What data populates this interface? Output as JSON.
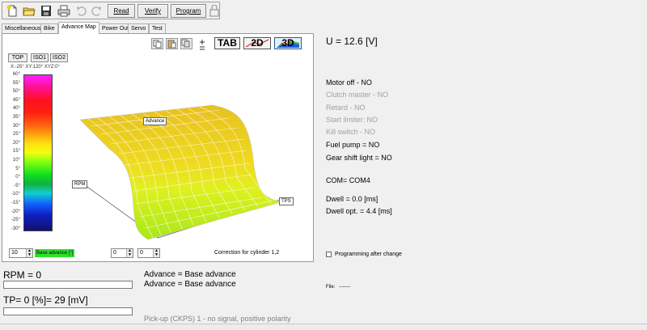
{
  "toolbar": {
    "icons": [
      "new-file-icon",
      "open-folder-icon",
      "save-icon",
      "print-icon",
      "undo-icon",
      "redo-icon",
      "lock-icon"
    ],
    "read_label": "Read",
    "verify_label": "Verify",
    "program_label": "Program"
  },
  "tabs": [
    {
      "label": "Miscellaneous"
    },
    {
      "label": "Bike"
    },
    {
      "label": "Advance Map",
      "active": true
    },
    {
      "label": "Power Out"
    },
    {
      "label": "Servo"
    },
    {
      "label": "Test"
    }
  ],
  "map_panel": {
    "view_buttons": {
      "top": "TOP",
      "iso1": "ISO1",
      "iso2": "ISO2"
    },
    "rotation_text": "X:-25° XY:120° XYZ:0°",
    "mode_buttons": {
      "tab": "TAB",
      "two_d": "2D",
      "three_d": "3D"
    },
    "color_scale": [
      "60°",
      "55°",
      "50°",
      "45°",
      "40°",
      "35°",
      "30°",
      "25°",
      "20°",
      "15°",
      "10°",
      "5°",
      "0°",
      "-5°",
      "-10°",
      "-15°",
      "-20°",
      "-25°",
      "-30°"
    ],
    "axis_labels": {
      "advance": "Advance",
      "rpm": "RPM",
      "tps": "TPS"
    },
    "zoom_value": "10",
    "base_advance_label": "Base advance [°]",
    "spin1_value": "0",
    "spin2_value": "0",
    "correction_text": "Correction for cylinder 1,2"
  },
  "status": {
    "voltage": "U = 12.6 [V]",
    "motor_off": "Motor off - NO",
    "clutch_master": "Clutch master - NO",
    "retard": "Retard - NO",
    "start_limiter": "Start limiter: NO",
    "kill_switch": "Kill switch - NO",
    "fuel_pump": "Fuel pump = NO",
    "gear_shift": "Gear shift light = NO",
    "com": "COM= COM4",
    "dwell": "Dwell = 0.0 [ms]",
    "dwell_opt": "Dwell opt. = 4.4 [ms]",
    "programming_after_change": "Programming after change",
    "file_label": "File:",
    "file_value": "-------"
  },
  "bottom": {
    "rpm": "RPM = 0",
    "rpm_progress": 0,
    "tp": "TP= 0 [%]= 29 [mV]",
    "tp_progress": 0,
    "advance1": "Advance = Base advance",
    "advance2": "Advance = Base advance",
    "pickup": "Pick-up (CKPS) 1 - no signal, positive polarity"
  },
  "colors": {
    "surface_top": "#e8c020",
    "surface_low": "#a8e81a",
    "panel_bg": "#ffffff",
    "window_bg": "#f0f0f0"
  }
}
